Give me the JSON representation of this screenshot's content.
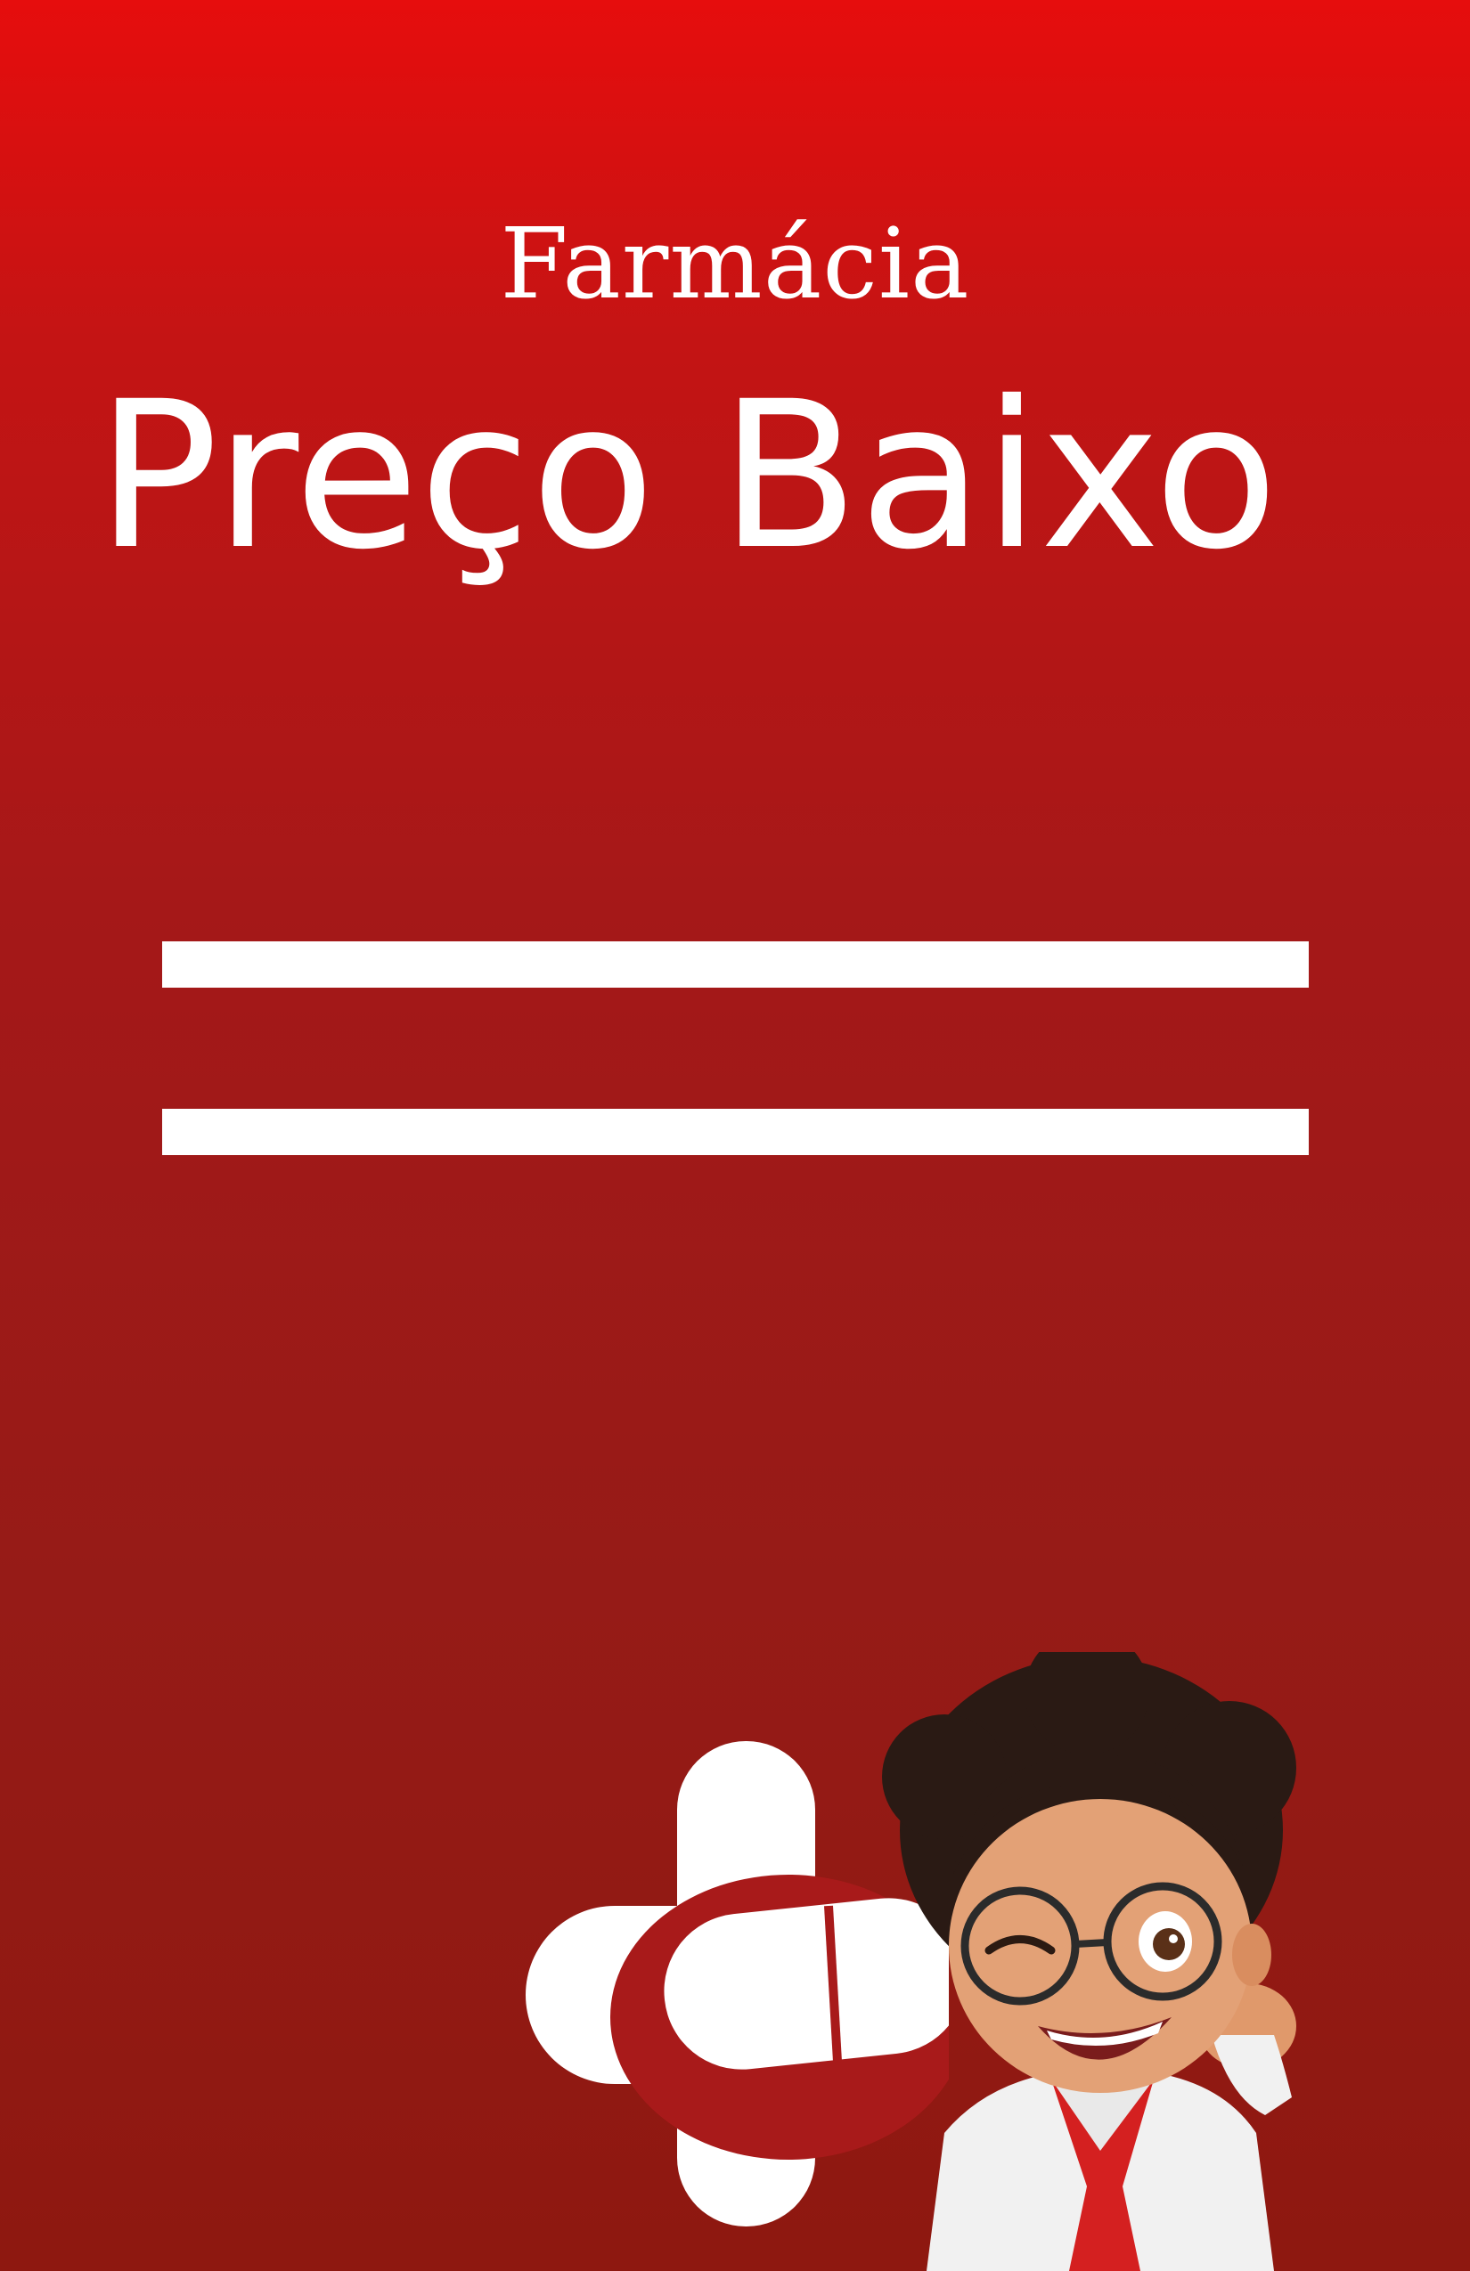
{
  "header": {
    "eyebrow": "Farmácia",
    "title": "Preço Baixo"
  },
  "colors": {
    "background_top": "#e60d0d",
    "background_bottom": "#8e1810",
    "foreground": "#ffffff"
  },
  "graphics": {
    "logo": "pharmacy-cross-capsule-logo",
    "mascot": "winking-pharmacist-cartoon"
  }
}
